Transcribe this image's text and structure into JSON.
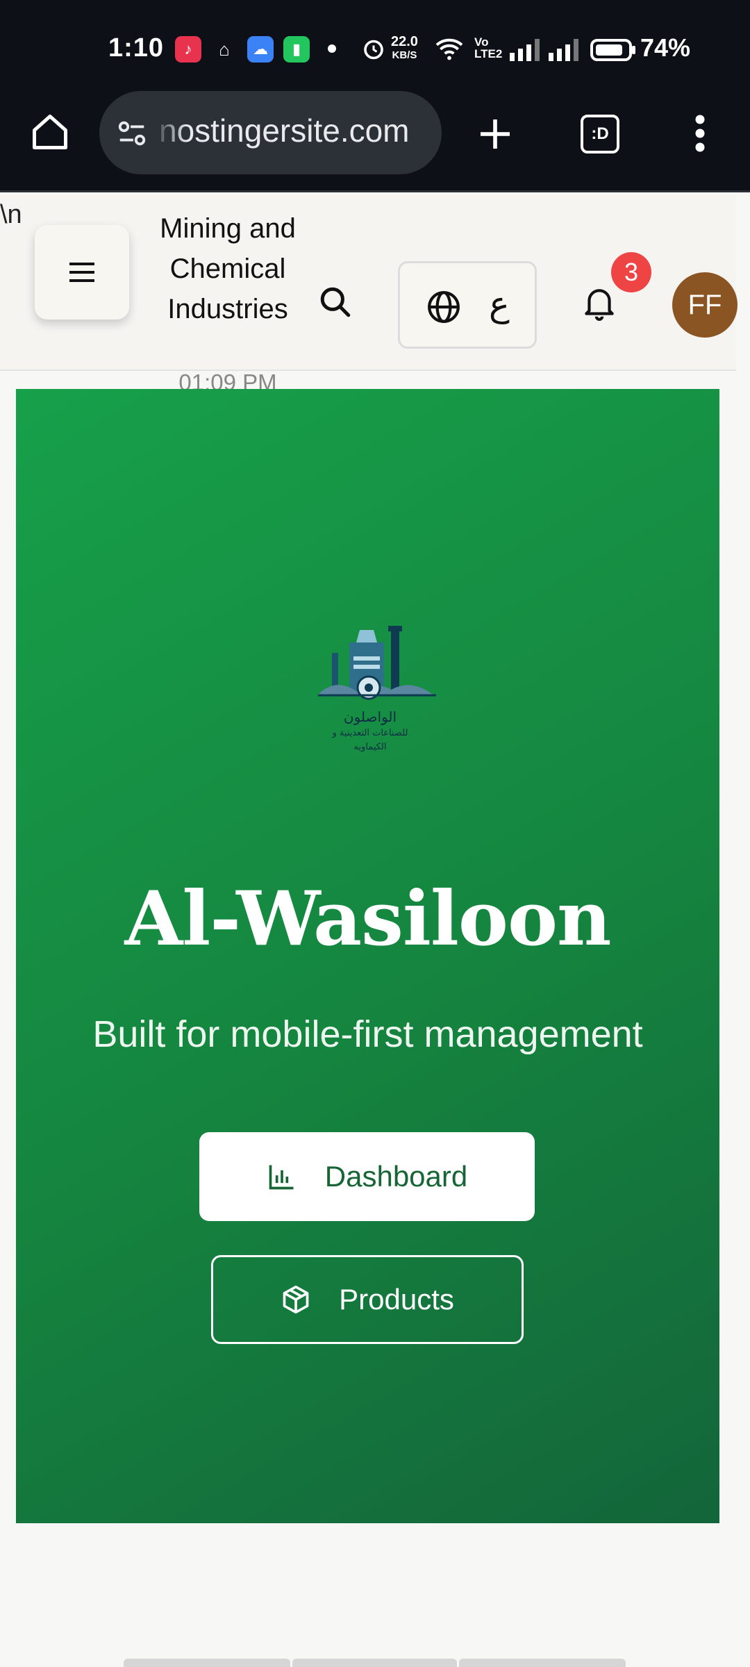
{
  "status_bar": {
    "time": "1:10",
    "net_speed_value": "22.0",
    "net_speed_unit": "KB/S",
    "volte_line1": "Vo",
    "volte_line2": "LTE2",
    "battery": "74%",
    "icons": [
      "music-app-icon",
      "mosque-icon",
      "weather-icon",
      "battery-saver-icon",
      "alarm-icon",
      "wifi-icon",
      "signal-icon",
      "battery-icon"
    ]
  },
  "browser": {
    "url": "nostingersite.com",
    "icons": [
      "home-icon",
      "site-settings-icon",
      "new-tab-icon",
      "tab-switcher-icon",
      "more-icon"
    ],
    "tab_label": ":D"
  },
  "header": {
    "stray_text": "\\n",
    "brand_title": "Mining and Chemical Industries",
    "brand_time": "01:09 PM",
    "language_label": "ع",
    "notification_count": "3",
    "avatar_initials": "FF"
  },
  "hero": {
    "logo_text_line1": "الواصلون",
    "logo_text_line2": "للصناعات التعدينية و",
    "logo_text_line3": "الكيماويه",
    "title": "Al-Wasiloon",
    "subtitle": "Built for mobile-first management",
    "primary_button": "Dashboard",
    "secondary_button": "Products"
  },
  "colors": {
    "hero_green": "#17a04a",
    "hero_dark_green": "#13653a",
    "badge_red": "#ef4444",
    "avatar_brown": "#8b5523",
    "button_text_green": "#166534"
  }
}
